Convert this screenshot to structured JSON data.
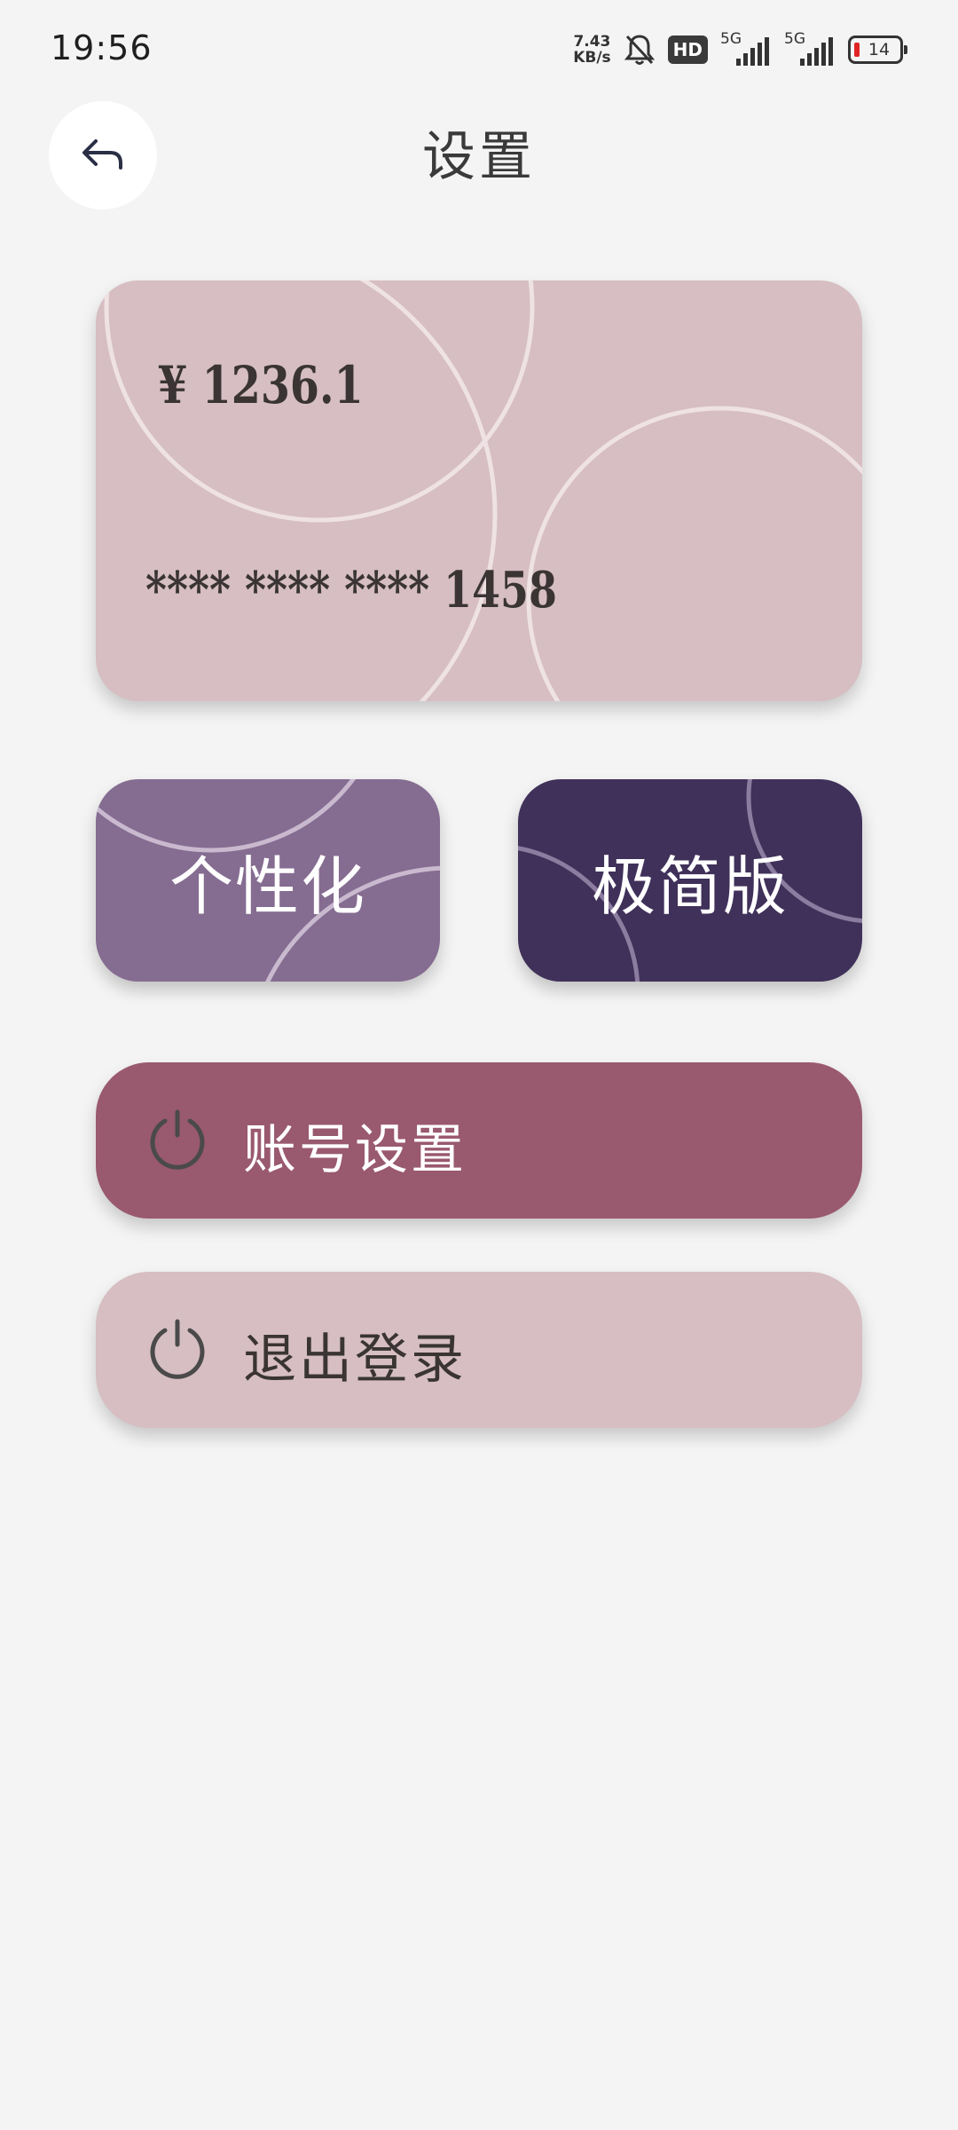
{
  "status_bar": {
    "time": "19:56",
    "net_speed_value": "7.43",
    "net_speed_unit": "KB/s",
    "hd_badge": "HD",
    "signal1_label": "5G",
    "signal2_label": "5G",
    "battery": "14",
    "icons": [
      "bell-muted-icon",
      "signal-icon",
      "battery-icon"
    ]
  },
  "header": {
    "title": "设置",
    "back_icon": "back-arrow-icon"
  },
  "balance_card": {
    "amount": "¥ 1236.1",
    "card_number": "**** **** **** 1458",
    "color": "#d6bec2"
  },
  "tiles": {
    "personalize": {
      "label": "个性化",
      "color": "#856c91"
    },
    "minimal": {
      "label": "极简版",
      "color": "#40315a"
    }
  },
  "actions": {
    "account": {
      "label": "账号设置",
      "icon": "power-icon",
      "color": "#99596e"
    },
    "logout": {
      "label": "退出登录",
      "icon": "power-icon",
      "color": "#d6bec2"
    }
  }
}
